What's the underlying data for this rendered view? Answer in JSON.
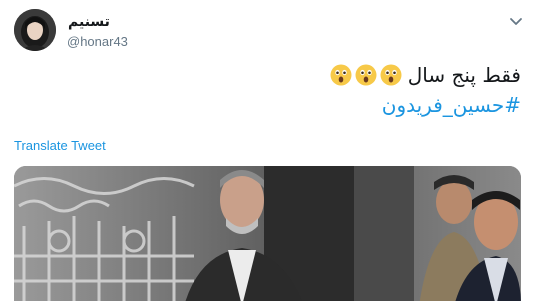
{
  "author": {
    "display_name": "تسنیم",
    "handle": "@honar43",
    "avatar_icon": "user-avatar"
  },
  "tweet": {
    "text": "فقط پنج سال",
    "emoji": [
      "astonished-face-icon",
      "astonished-face-icon",
      "astonished-face-icon"
    ],
    "hashtag": "#حسين_فريدون"
  },
  "actions": {
    "translate_label": "Translate Tweet",
    "menu_icon": "chevron-down-icon"
  },
  "colors": {
    "link": "#1b95e0",
    "text": "#14171a",
    "secondary": "#657786"
  },
  "media": {
    "type": "photo",
    "icon": "photo-icon"
  }
}
